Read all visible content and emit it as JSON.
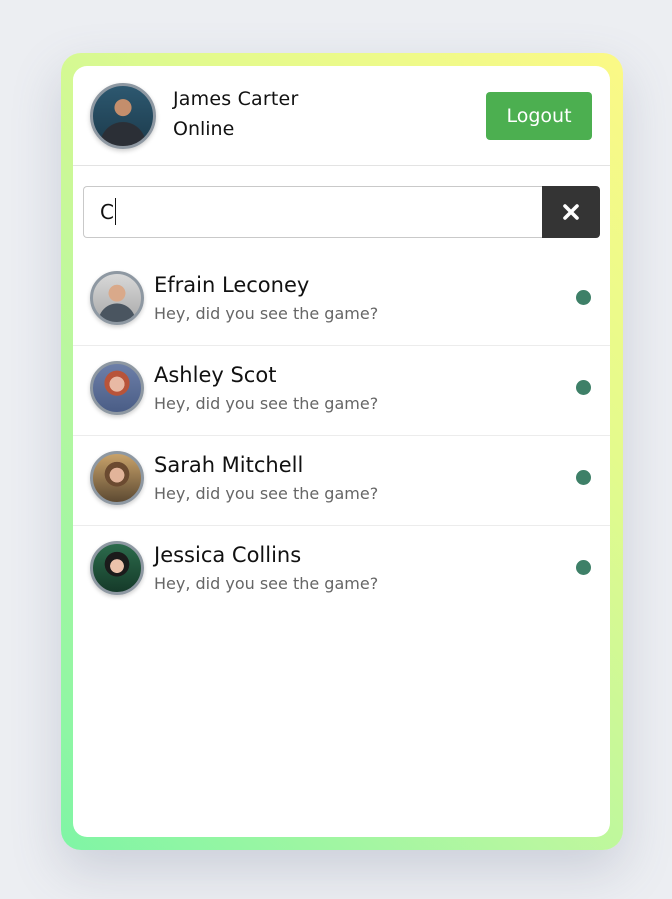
{
  "user": {
    "name": "James Carter",
    "status": "Online"
  },
  "header": {
    "logout_label": "Logout"
  },
  "search": {
    "value": "C",
    "clear_icon": "close-icon"
  },
  "colors": {
    "online_dot": "#3e8068",
    "logout_bg": "#4caf50",
    "clear_bg": "#343434"
  },
  "contacts": [
    {
      "name": "Efrain Leconey",
      "message": "Hey, did you see the game?",
      "status": "online"
    },
    {
      "name": "Ashley Scot",
      "message": "Hey, did you see the game?",
      "status": "online"
    },
    {
      "name": "Sarah Mitchell",
      "message": "Hey, did you see the game?",
      "status": "online"
    },
    {
      "name": "Jessica Collins",
      "message": "Hey, did you see the game?",
      "status": "online"
    }
  ]
}
